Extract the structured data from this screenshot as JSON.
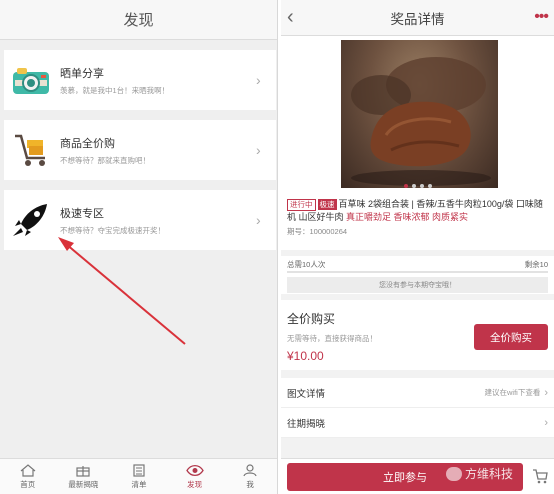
{
  "left": {
    "title": "发现",
    "cards": [
      {
        "icon": "camera-icon",
        "title": "晒单分享",
        "subtitle": "羡慕，就是我中1台！来晒我啊！"
      },
      {
        "icon": "cart-icon",
        "title": "商品全价购",
        "subtitle": "不想等待？那就来直购吧！"
      },
      {
        "icon": "rocket-icon",
        "title": "极速专区",
        "subtitle": "不想等待？夺宝完成极速开奖！"
      }
    ],
    "tabs": [
      {
        "label": "首页",
        "icon": "home-icon",
        "active": false
      },
      {
        "label": "最新揭晓",
        "icon": "gift-icon",
        "active": false
      },
      {
        "label": "清单",
        "icon": "list-icon",
        "active": false
      },
      {
        "label": "发现",
        "icon": "eye-icon",
        "active": true
      },
      {
        "label": "我",
        "icon": "person-icon",
        "active": false
      }
    ]
  },
  "right": {
    "title": "奖品详情",
    "back": "‹",
    "more": "•••",
    "product": {
      "status": "进行中",
      "tag": "极速",
      "name_main": "百草味 2袋组合装 | 香辣/五香牛肉粒100g/袋 口味随机 山区好牛肉 ",
      "name_highlight": "真正嚼劲足 香味浓郁 肉质紧实",
      "period": "期号：100000264"
    },
    "progress": {
      "total": "总需10人次",
      "remain": "剩余10",
      "fraction": 0,
      "notice": "您没有参与本期夺宝哦！"
    },
    "buy": {
      "title": "全价购买",
      "subtitle": "无需等待，直接获得商品！",
      "price": "¥10.00",
      "button": "全价购买"
    },
    "rows": [
      {
        "label": "图文详情",
        "hint": "建议在wifi下查看"
      },
      {
        "label": "往期揭晓",
        "hint": ""
      }
    ],
    "join_button": "立即参与",
    "watermark": "方维科技"
  },
  "colors": {
    "accent": "#c0344a",
    "arrow": "#d9323a"
  }
}
